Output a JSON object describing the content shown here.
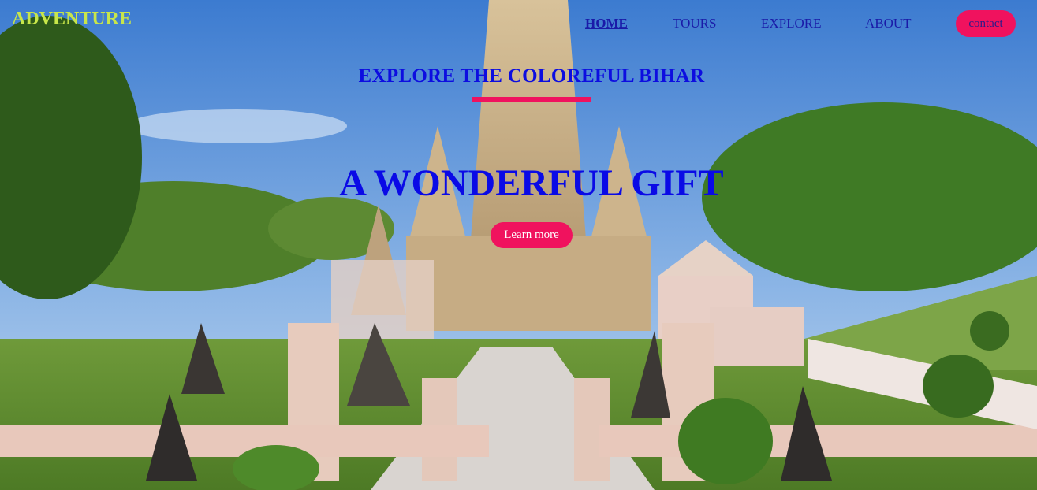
{
  "brand": "ADVENTURE",
  "nav": {
    "items": [
      {
        "label": "HOME",
        "active": true
      },
      {
        "label": "TOURS",
        "active": false
      },
      {
        "label": "EXPLORE",
        "active": false
      },
      {
        "label": "ABOUT",
        "active": false
      }
    ],
    "contact_label": "contact"
  },
  "hero": {
    "subtitle": "EXPLORE THE COLOREFUL BIHAR",
    "title": "A WONDERFUL GIFT",
    "cta_label": "Learn more"
  },
  "colors": {
    "accent": "#f0125e",
    "brand": "#c8e64a",
    "heading": "#0a0ae6",
    "nav_text": "#1a1aa8"
  },
  "background": {
    "icon": "temple-landscape-photo"
  }
}
